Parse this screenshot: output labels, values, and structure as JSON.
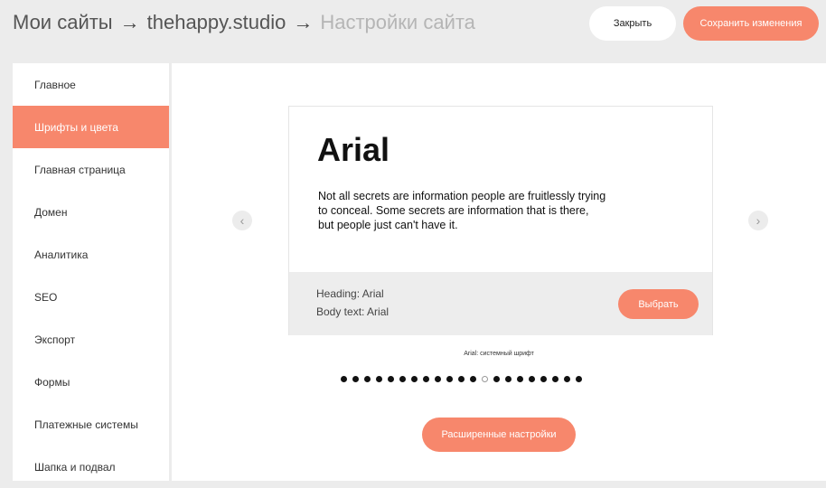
{
  "header": {
    "breadcrumb": [
      "Мои сайты",
      "thehappy.studio",
      "Настройки сайта"
    ],
    "separator": "→",
    "close_label": "Закрыть",
    "save_label": "Сохранить изменения"
  },
  "sidebar": {
    "items": [
      {
        "label": "Главное"
      },
      {
        "label": "Шрифты и цвета",
        "active": true
      },
      {
        "label": "Главная страница"
      },
      {
        "label": "Домен"
      },
      {
        "label": "Аналитика"
      },
      {
        "label": "SEO"
      },
      {
        "label": "Экспорт"
      },
      {
        "label": "Формы"
      },
      {
        "label": "Платежные системы"
      },
      {
        "label": "Шапка и подвал"
      }
    ]
  },
  "preview": {
    "font_name": "Arial",
    "sample_text": "Not all secrets are information people are fruitlessly trying to conceal. Some secrets are information that is there, but people just can't have it.",
    "heading_line": "Heading: Arial",
    "body_line": "Body text: Arial",
    "choose_label": "Выбрать",
    "caption": "Arial: системный шрифт"
  },
  "carousel": {
    "total": 21,
    "active_index": 12,
    "prev_icon": "chevron-left-icon",
    "next_icon": "chevron-right-icon"
  },
  "advanced_label": "Расширенные настройки",
  "colors": {
    "accent": "#f7876c",
    "background": "#ececec"
  }
}
